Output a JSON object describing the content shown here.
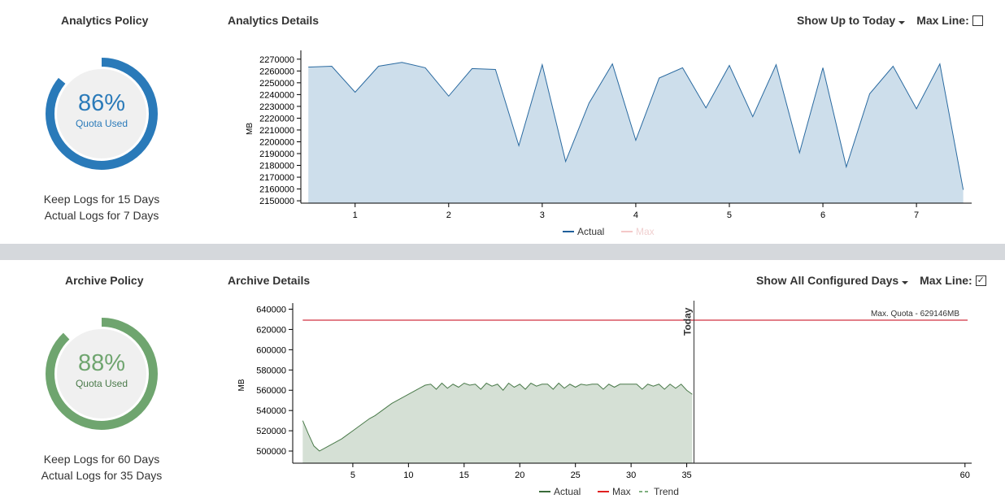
{
  "analytics": {
    "policy_title": "Analytics Policy",
    "details_title": "Analytics Details",
    "quota_percent": 86,
    "quota_label": "86%",
    "quota_sub": "Quota Used",
    "keep_logs": "Keep Logs for 15 Days",
    "actual_logs": "Actual Logs for 7 Days",
    "show_label": "Show",
    "show_value": "Up to Today",
    "max_line_label": "Max Line:",
    "max_line_checked": false,
    "color": "#2a7ab9"
  },
  "archive": {
    "policy_title": "Archive Policy",
    "details_title": "Archive Details",
    "quota_percent": 88,
    "quota_label": "88%",
    "quota_sub": "Quota Used",
    "keep_logs": "Keep Logs for 60 Days",
    "actual_logs": "Actual Logs for 35 Days",
    "show_label": "Show",
    "show_value": "All Configured Days",
    "max_line_label": "Max Line:",
    "max_line_checked": true,
    "color": "#6fa56f"
  },
  "chart_data": [
    {
      "type": "area",
      "ylabel": "MB",
      "xlim": [
        0.42,
        7.59
      ],
      "ylim": [
        2148000,
        2274000
      ],
      "xticks": [
        1,
        2,
        3,
        4,
        5,
        6,
        7
      ],
      "yticks": [
        2150000,
        2160000,
        2170000,
        2180000,
        2190000,
        2200000,
        2210000,
        2220000,
        2230000,
        2240000,
        2250000,
        2260000,
        2270000
      ],
      "legend": [
        "Actual",
        "Max"
      ],
      "legend_colors": [
        "#1f5f9a",
        "#f4c8c8"
      ],
      "x": [
        0.5,
        0.75,
        1,
        1.25,
        1.5,
        1.75,
        2,
        2.25,
        2.5,
        2.75,
        3,
        3.25,
        3.5,
        3.75,
        4,
        4.25,
        4.5,
        4.75,
        5,
        5.25,
        5.5,
        5.75,
        6,
        6.25,
        6.5,
        6.75,
        7,
        7.25,
        7.5
      ],
      "y": [
        2263300,
        2264000,
        2242000,
        2264000,
        2267300,
        2262700,
        2238700,
        2262000,
        2261300,
        2196700,
        2265300,
        2183300,
        2232700,
        2266000,
        2201300,
        2254000,
        2262700,
        2228700,
        2264700,
        2221300,
        2265300,
        2190700,
        2262700,
        2178700,
        2240700,
        2264000,
        2228000,
        2266000,
        2159300
      ]
    },
    {
      "type": "area",
      "ylabel": "MB",
      "xlim": [
        -0.4,
        60.6
      ],
      "ylim": [
        488000,
        642000
      ],
      "xticks": [
        5,
        10,
        15,
        20,
        25,
        30,
        35,
        60
      ],
      "yticks": [
        500000,
        520000,
        540000,
        560000,
        580000,
        600000,
        620000,
        640000
      ],
      "legend": [
        "Actual",
        "Max",
        "Trend"
      ],
      "legend_colors": [
        "#3a6b3a",
        "#e02020",
        "#7fb07f"
      ],
      "max_quota": 629146,
      "max_label": "Max. Quota - 629146MB",
      "today_x": 35.65,
      "today_label": "Today",
      "x_start": 0.5,
      "x_step": 0.5,
      "y": [
        530000,
        517000,
        505000,
        500000,
        503000,
        506000,
        509000,
        512000,
        516000,
        520000,
        524000,
        528000,
        532000,
        535000,
        539000,
        543000,
        547000,
        550000,
        553000,
        556000,
        559000,
        562000,
        565000,
        566000,
        561000,
        567000,
        562000,
        566000,
        563000,
        567000,
        565000,
        566000,
        561000,
        567000,
        564000,
        566000,
        560000,
        567000,
        563000,
        566000,
        561000,
        567000,
        564000,
        566000,
        566000,
        561000,
        567000,
        562000,
        566000,
        563000,
        566000,
        565000,
        566000,
        566000,
        561000,
        566000,
        563000,
        566000,
        566000,
        566000,
        566000,
        561000,
        566000,
        564000,
        566000,
        561000,
        566000,
        562000,
        566000,
        560000,
        556000
      ]
    }
  ]
}
